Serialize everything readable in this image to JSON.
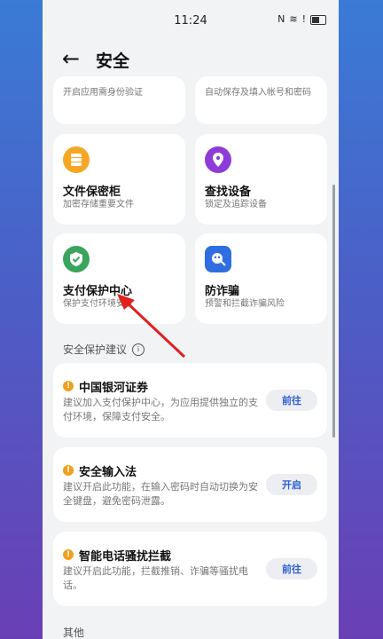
{
  "status_bar": {
    "time": "11:24",
    "nfc": "N",
    "wifi": "≋",
    "alert": "!"
  },
  "header": {
    "back": "←",
    "title": "安全"
  },
  "top_tiles": [
    {
      "desc": "开启应用需身份验证"
    },
    {
      "desc": "自动保存及填入帐号和密码"
    }
  ],
  "tiles": [
    {
      "name": "文件保密柜",
      "desc": "加密存储重要文件",
      "icon": "safe-box-icon",
      "color": "#f5a623"
    },
    {
      "name": "查找设备",
      "desc": "锁定及追踪设备",
      "icon": "location-pin-icon",
      "color": "#8e3bd9"
    },
    {
      "name": "支付保护中心",
      "desc": "保护支付环境安全",
      "icon": "shield-check-icon",
      "color": "#3aa35c"
    },
    {
      "name": "防诈骗",
      "desc": "预警和拦截诈骗风险",
      "icon": "anti-fraud-icon",
      "color": "#2f6ee0"
    }
  ],
  "sections": {
    "suggestions": "安全保护建议",
    "info": "i",
    "other": "其他"
  },
  "suggestions": [
    {
      "title": "中国银河证券",
      "desc": "建议加入支付保护中心，为应用提供独立的支付环境，保障支付安全。",
      "button": "前往"
    },
    {
      "title": "安全输入法",
      "desc": "建议开启此功能，在输入密码时自动切换为安全键盘，避免密码泄露。",
      "button": "开启"
    },
    {
      "title": "智能电话骚扰拦截",
      "desc": "建议开启此功能，拦截推销、诈骗等骚扰电话。",
      "button": "前往"
    }
  ],
  "colors": {
    "accent": "#2e5fd8",
    "warning": "#f0a020",
    "arrow": "#e02020"
  }
}
